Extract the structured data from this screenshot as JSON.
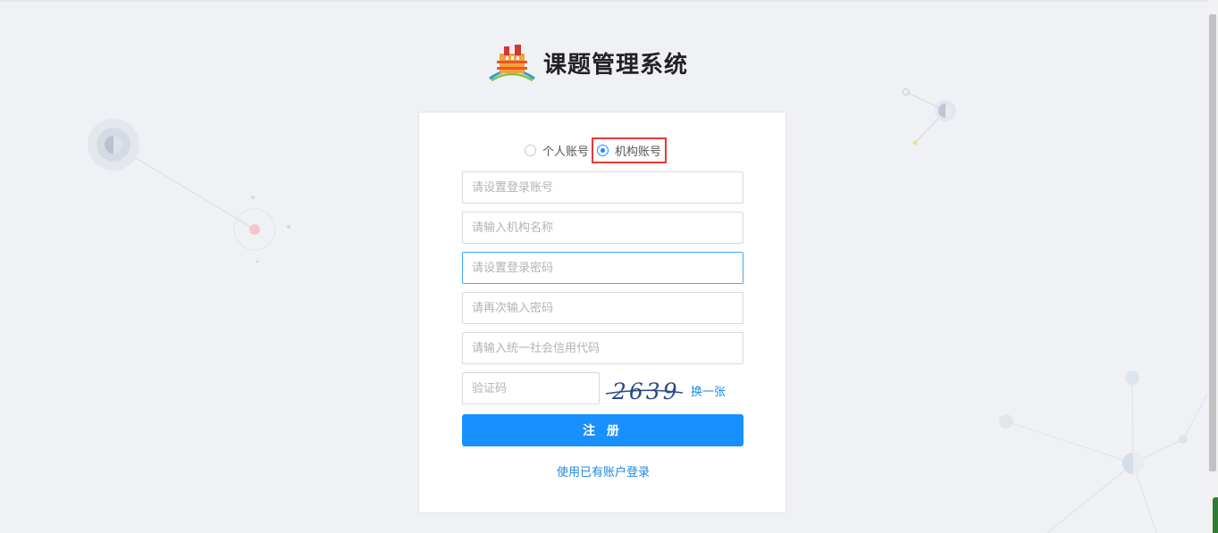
{
  "header": {
    "title": "课题管理系统"
  },
  "account_type": {
    "options": [
      {
        "label": "个人账号",
        "selected": false
      },
      {
        "label": "机构账号",
        "selected": true
      }
    ]
  },
  "form": {
    "username_placeholder": "请设置登录账号",
    "org_name_placeholder": "请输入机构名称",
    "password_placeholder": "请设置登录密码",
    "password_confirm_placeholder": "请再次输入密码",
    "credit_code_placeholder": "请输入统一社会信用代码",
    "captcha_placeholder": "验证码",
    "captcha_text": "2639",
    "captcha_refresh": "换一张",
    "register_button": "注 册",
    "login_link": "使用已有账户登录"
  },
  "colors": {
    "primary": "#1890ff",
    "link": "#1e88e5",
    "highlight_box": "#e53935"
  }
}
